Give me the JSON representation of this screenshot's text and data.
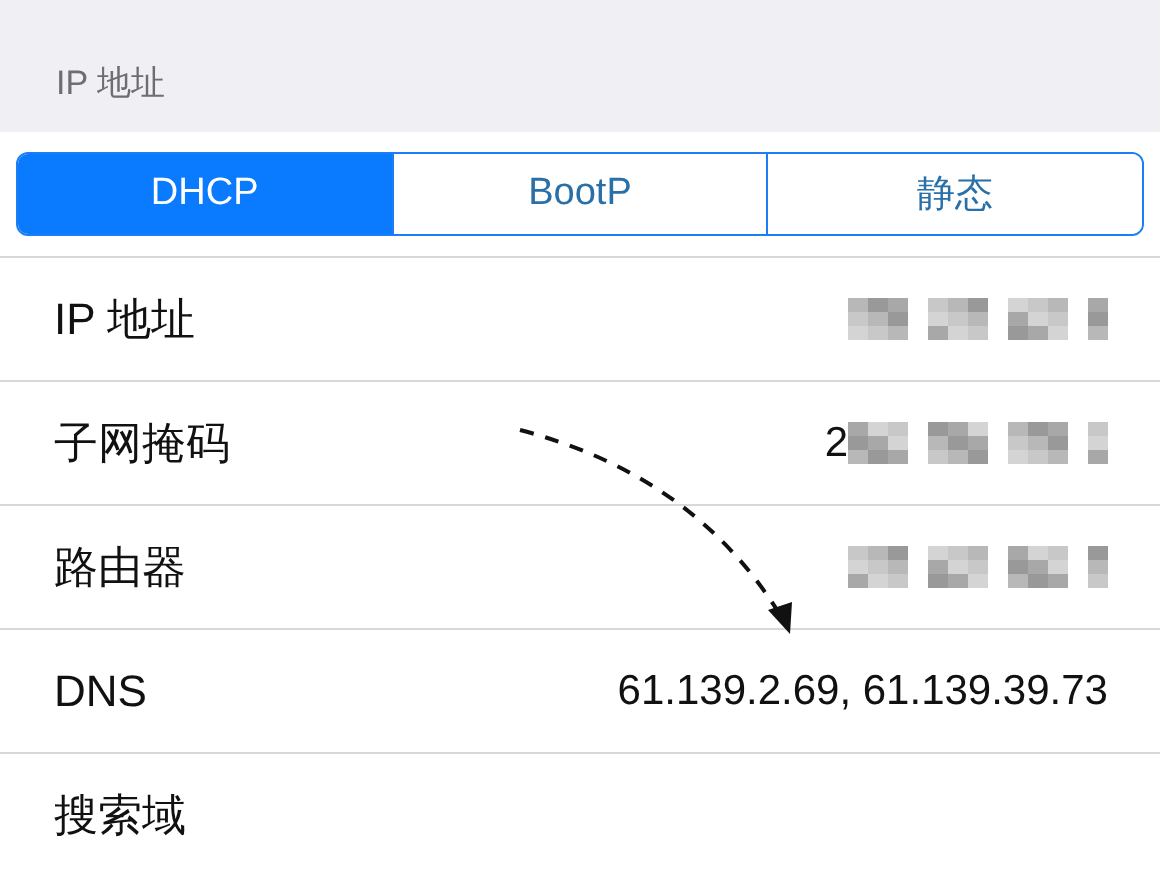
{
  "section_header": "IP 地址",
  "segments": [
    {
      "label": "DHCP",
      "selected": true
    },
    {
      "label": "BootP",
      "selected": false
    },
    {
      "label": "静态",
      "selected": false
    }
  ],
  "rows": [
    {
      "label": "IP 地址",
      "blurred": true
    },
    {
      "label": "子网掩码",
      "value": "2",
      "blurred": true
    },
    {
      "label": "路由器",
      "blurred": true
    },
    {
      "label": "DNS",
      "value": "61.139.2.69, 61.139.39.73",
      "blurred": false
    },
    {
      "label": "搜索域",
      "blurred": false
    }
  ]
}
